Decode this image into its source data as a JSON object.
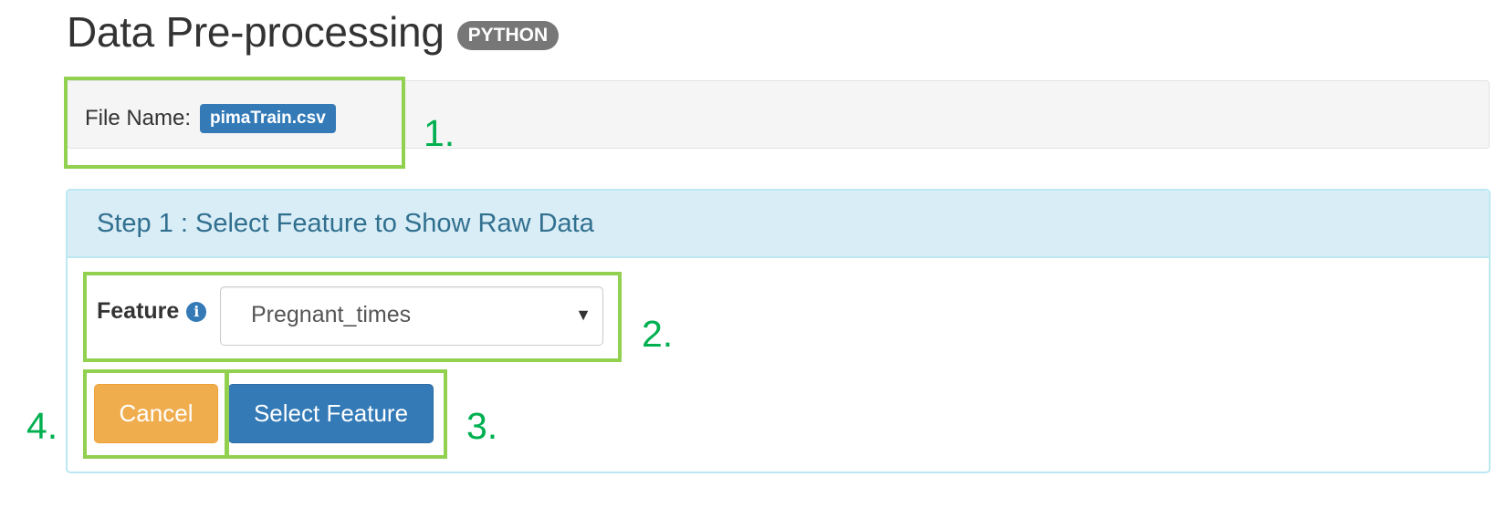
{
  "header": {
    "title": "Data Pre-processing",
    "language_badge": "PYTHON"
  },
  "file": {
    "label": "File Name:",
    "name": "pimaTrain.csv"
  },
  "panel": {
    "title": "Step 1 : Select Feature to Show Raw Data",
    "feature_label": "Feature",
    "info_icon": "info-circle-icon",
    "feature_select": {
      "value": "Pregnant_times",
      "caret": "▼"
    },
    "buttons": {
      "cancel": "Cancel",
      "select_feature": "Select Feature"
    }
  },
  "annotations": {
    "n1": "1.",
    "n2": "2.",
    "n3": "3.",
    "n4": "4."
  },
  "colors": {
    "annotation_box": "#92d050",
    "annotation_number": "#00b050",
    "primary": "#337ab7",
    "warning": "#f0ad4e",
    "panel_heading_bg": "#d9edf7",
    "panel_heading_text": "#31708f"
  }
}
